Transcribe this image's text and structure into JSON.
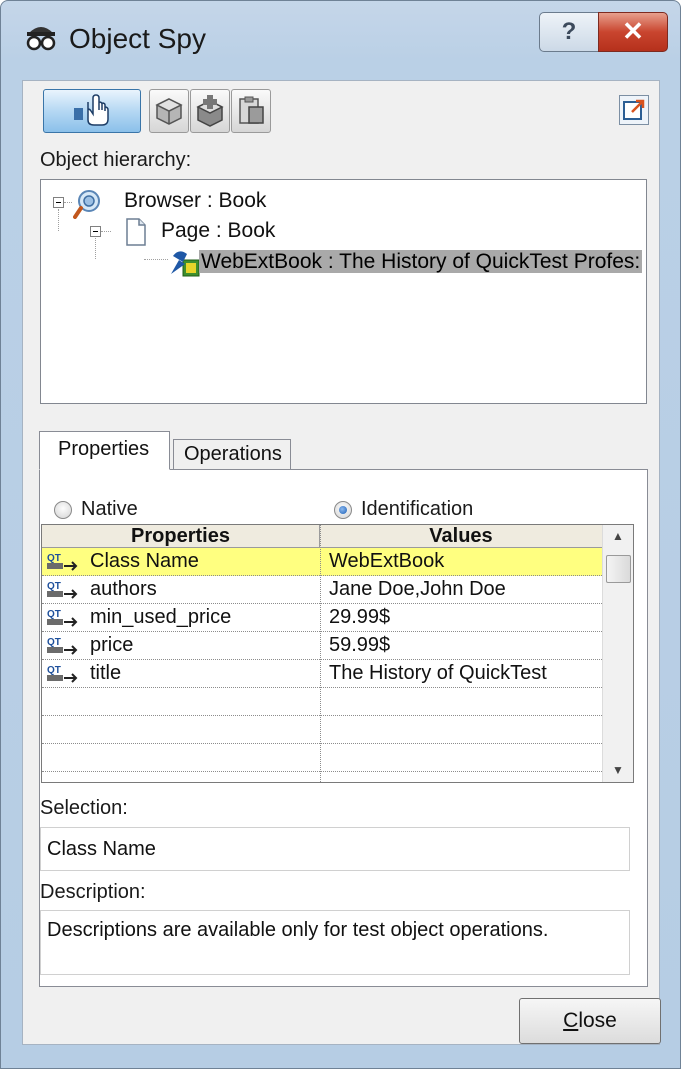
{
  "window": {
    "title": "Object Spy",
    "help_label": "?",
    "close_glyph": "x"
  },
  "icons": {
    "app": "spy-icon",
    "pointer": "hand-pointer-icon",
    "object": "cube-icon",
    "add_object": "add-object-icon",
    "highlight": "copy-object-icon",
    "export": "export-icon",
    "browser": "browser-icon",
    "page": "page-icon",
    "webextbook": "web-ext-book-icon",
    "property": "qt-property-icon"
  },
  "hierarchy": {
    "label": "Object hierarchy:",
    "nodes": [
      {
        "text": "Browser : Book"
      },
      {
        "text": "Page : Book"
      },
      {
        "text": "WebExtBook : The History of QuickTest Profes:"
      }
    ]
  },
  "tabs": [
    {
      "label": "Properties",
      "active": true
    },
    {
      "label": "Operations",
      "active": false
    }
  ],
  "radios": {
    "native_label": "Native",
    "identification_label": "Identification",
    "selected": "Identification"
  },
  "grid": {
    "headers": [
      "Properties",
      "Values"
    ],
    "rows": [
      {
        "property": "Class Name",
        "value": "WebExtBook",
        "selected": true
      },
      {
        "property": "authors",
        "value": "Jane Doe,John Doe",
        "selected": false
      },
      {
        "property": "min_used_price",
        "value": "29.99$",
        "selected": false
      },
      {
        "property": "price",
        "value": "59.99$",
        "selected": false
      },
      {
        "property": "title",
        "value": "The History of QuickTest",
        "selected": false
      }
    ],
    "empty_rows": 3
  },
  "selection": {
    "label": "Selection:",
    "value": "Class Name"
  },
  "description": {
    "label": "Description:",
    "value": "Descriptions are available only for test object operations."
  },
  "buttons": {
    "close_label_rest": "lose",
    "close_label_mnemonic": "C"
  },
  "colors": {
    "selected_row": "#ffff80",
    "title_gradient_top": "#c5d6e9",
    "close_button_red": "#c9452f"
  }
}
